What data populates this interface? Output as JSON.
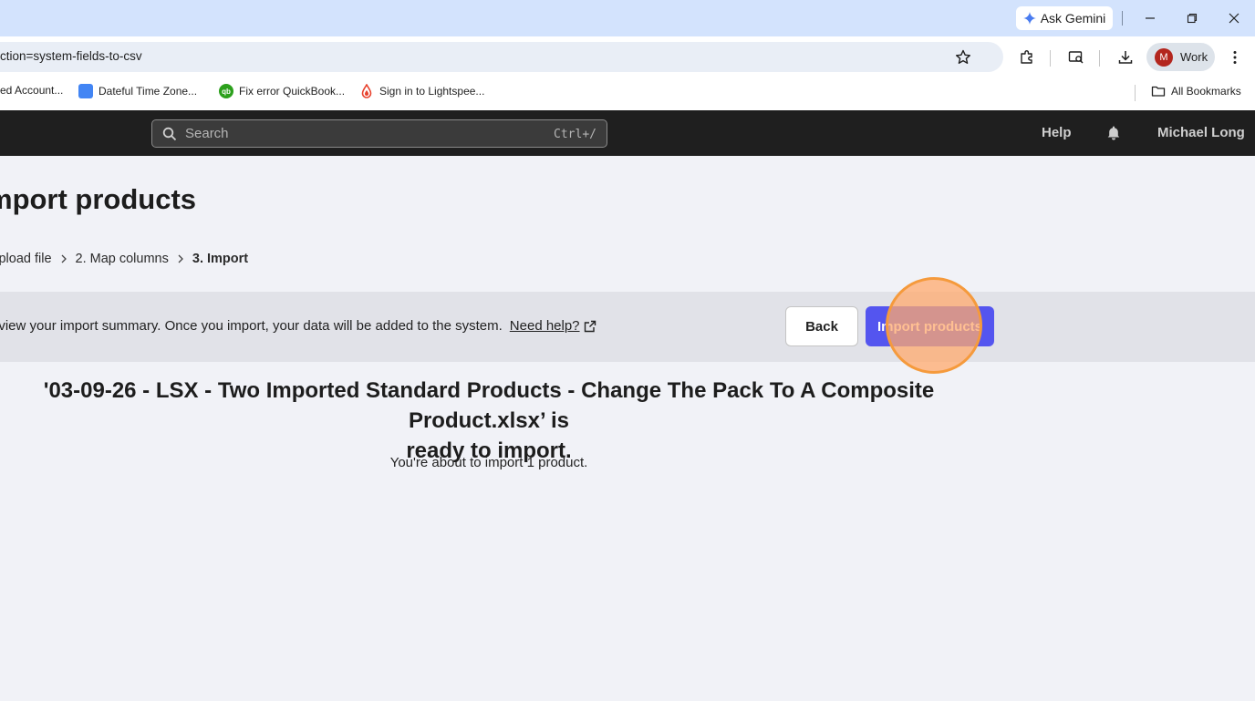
{
  "browser": {
    "ask_gemini": "Ask Gemini",
    "url": "ction=system-fields-to-csv",
    "profile": {
      "initial": "M",
      "label": "Work"
    },
    "bookmarks": [
      {
        "label": "ed Account...",
        "icon": "none"
      },
      {
        "label": "Dateful Time Zone...",
        "icon": "calendar-icon",
        "color": "#4285f4"
      },
      {
        "label": "Fix error QuickBook...",
        "icon": "quickbooks-icon",
        "color": "#2ca01c"
      },
      {
        "label": "Sign in to Lightspee...",
        "icon": "lightspeed-icon",
        "color": "#e8412c"
      }
    ],
    "all_bookmarks": "All Bookmarks"
  },
  "header": {
    "search_placeholder": "Search",
    "search_shortcut": "Ctrl+/",
    "help": "Help",
    "user": "Michael Long"
  },
  "page": {
    "title": "mport products",
    "steps": [
      "Upload file",
      "2. Map columns",
      "3. Import"
    ],
    "banner_text": "eview your import summary. Once you import, your data will be added to the system.",
    "need_help": "Need help?",
    "back": "Back",
    "import": "Import products",
    "summary_line1": "'03-09-26 - LSX - Two Imported Standard Products - Change The Pack To A Composite Product.xlsx’ is",
    "summary_line2": "ready to import.",
    "count_text": "You're about to import 1 product."
  },
  "colors": {
    "accent": "#5455ef",
    "header_bg": "#1f1f1f",
    "highlight": "#f59a3c"
  }
}
